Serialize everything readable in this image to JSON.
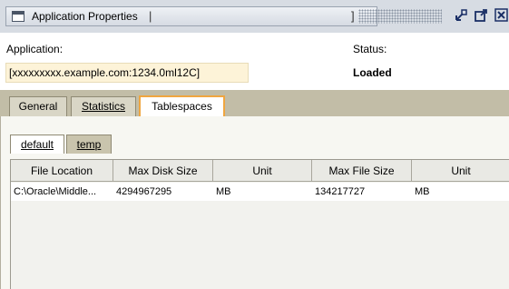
{
  "window": {
    "title": "Application Properties",
    "title_caret": "|",
    "title_bracket": "]",
    "restore_icon": "undock-icon",
    "maximize_icon": "maximize-icon",
    "close_icon": "close-icon"
  },
  "info": {
    "application_label": "Application:",
    "application_value": "[xxxxxxxxx.example.com:1234.0ml12C]",
    "status_label": "Status:",
    "status_value": "Loaded"
  },
  "tabs": [
    {
      "label": "General",
      "active": false
    },
    {
      "label": "Statistics",
      "active": false
    },
    {
      "label": "Tablespaces",
      "active": true
    }
  ],
  "subtabs": [
    {
      "label": "default",
      "active": true
    },
    {
      "label": "temp",
      "active": false
    }
  ],
  "table": {
    "columns": [
      "File Location",
      "Max Disk Size",
      "Unit",
      "Max File Size",
      "Unit"
    ],
    "rows": [
      [
        "C:\\Oracle\\Middle...",
        "4294967295",
        "MB",
        "134217727",
        "MB"
      ]
    ]
  },
  "colors": {
    "tab_strip": "#c2bda7",
    "active_tab_border": "#f0a640",
    "app_value_bg": "#fdf3d8"
  }
}
